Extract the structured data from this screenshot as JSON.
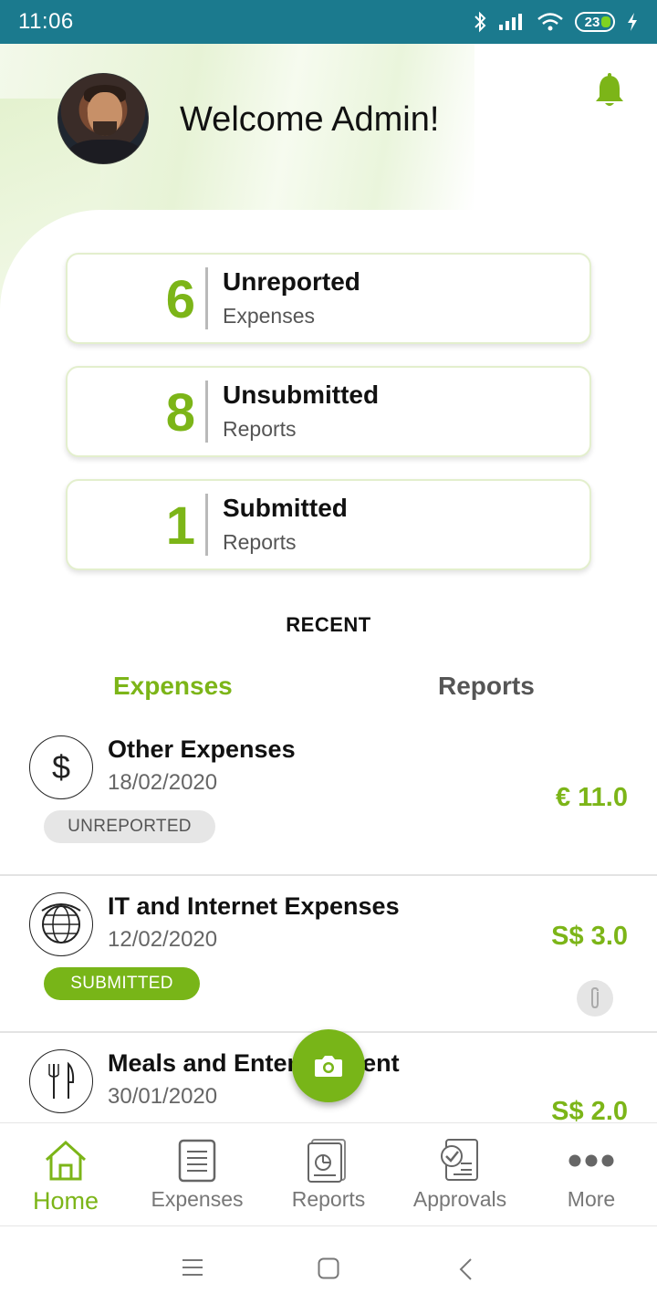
{
  "status_bar": {
    "time": "11:06",
    "battery": "23"
  },
  "header": {
    "welcome": "Welcome Admin!"
  },
  "stats": [
    {
      "count": "6",
      "title": "Unreported",
      "subtitle": "Expenses"
    },
    {
      "count": "8",
      "title": "Unsubmitted",
      "subtitle": "Reports"
    },
    {
      "count": "1",
      "title": "Submitted",
      "subtitle": "Reports"
    }
  ],
  "recent": {
    "title": "RECENT",
    "tabs": [
      "Expenses",
      "Reports"
    ],
    "items": [
      {
        "title": "Other Expenses",
        "date": "18/02/2020",
        "status": "UNREPORTED",
        "amount": "€ 11.0",
        "icon": "dollar-icon"
      },
      {
        "title": "IT and Internet Expenses",
        "date": "12/02/2020",
        "status": "SUBMITTED",
        "amount": "S$ 3.0",
        "icon": "globe-icon"
      },
      {
        "title": "Meals and Entertainment",
        "date": "30/01/2020",
        "status": "",
        "amount": "S$ 2.0",
        "icon": "fork-knife-icon"
      }
    ]
  },
  "bottom_nav": [
    {
      "label": "Home",
      "icon": "home-icon",
      "active": true
    },
    {
      "label": "Expenses",
      "icon": "expenses-icon"
    },
    {
      "label": "Reports",
      "icon": "reports-icon"
    },
    {
      "label": "Approvals",
      "icon": "approvals-icon"
    },
    {
      "label": "More",
      "icon": "more-icon"
    }
  ],
  "colors": {
    "accent": "#7cb518",
    "status_bar": "#1b7a8e"
  }
}
